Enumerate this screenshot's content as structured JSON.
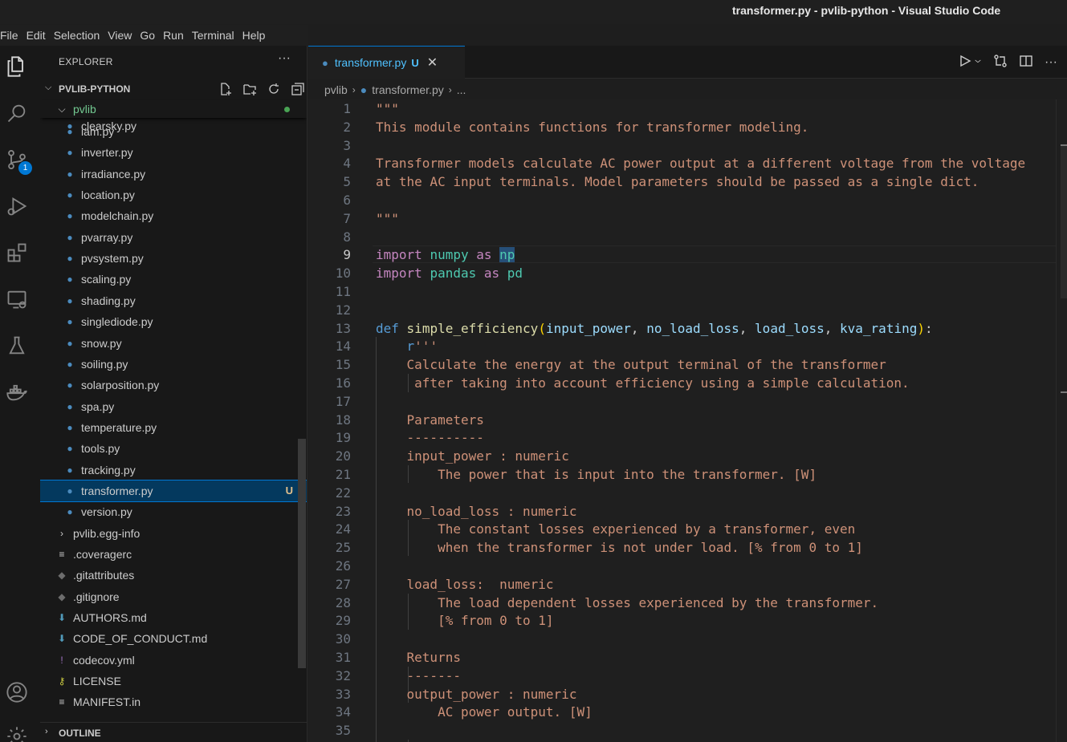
{
  "window": {
    "title": "transformer.py - pvlib-python - Visual Studio Code"
  },
  "menu": [
    "File",
    "Edit",
    "Selection",
    "View",
    "Go",
    "Run",
    "Terminal",
    "Help"
  ],
  "activity_bar": {
    "scm_badge": "1"
  },
  "explorer": {
    "header": "EXPLORER",
    "more": "···",
    "project": "PVLIB-PYTHON",
    "folder": "pvlib",
    "files": [
      {
        "name": "clearsky.py"
      },
      {
        "name": "iam.py"
      },
      {
        "name": "inverter.py"
      },
      {
        "name": "irradiance.py"
      },
      {
        "name": "location.py"
      },
      {
        "name": "modelchain.py"
      },
      {
        "name": "pvarray.py"
      },
      {
        "name": "pvsystem.py"
      },
      {
        "name": "scaling.py"
      },
      {
        "name": "shading.py"
      },
      {
        "name": "singlediode.py"
      },
      {
        "name": "snow.py"
      },
      {
        "name": "soiling.py"
      },
      {
        "name": "solarposition.py"
      },
      {
        "name": "spa.py"
      },
      {
        "name": "temperature.py"
      },
      {
        "name": "tools.py"
      },
      {
        "name": "tracking.py"
      },
      {
        "name": "transformer.py",
        "status": "U",
        "selected": true
      },
      {
        "name": "version.py"
      }
    ],
    "root_items": [
      {
        "name": "pvlib.egg-info",
        "icon": "chevron-right-icon"
      },
      {
        "name": ".coveragerc",
        "icon": "lines-icon"
      },
      {
        "name": ".gitattributes",
        "icon": "git-icon"
      },
      {
        "name": ".gitignore",
        "icon": "git-icon"
      },
      {
        "name": "AUTHORS.md",
        "icon": "markdown-icon"
      },
      {
        "name": "CODE_OF_CONDUCT.md",
        "icon": "markdown-icon"
      },
      {
        "name": "codecov.yml",
        "icon": "yaml-icon"
      },
      {
        "name": "LICENSE",
        "icon": "license-icon"
      },
      {
        "name": "MANIFEST.in",
        "icon": "lines-icon"
      }
    ],
    "outline": "OUTLINE"
  },
  "tab": {
    "name": "transformer.py",
    "status": "U"
  },
  "breadcrumb": {
    "folder": "pvlib",
    "file": "transformer.py",
    "more": "..."
  },
  "editor": {
    "current_line": 9,
    "lines": [
      "\"\"\"",
      "This module contains functions for transformer modeling.",
      "",
      "Transformer models calculate AC power output at a different voltage from the voltage",
      "at the AC input terminals. Model parameters should be passed as a single dict.",
      "",
      "\"\"\"",
      "",
      "import numpy as np",
      "import pandas as pd",
      "",
      "",
      "def simple_efficiency(input_power, no_load_loss, load_loss, kva_rating):",
      "    r'''",
      "    Calculate the energy at the output terminal of the transformer",
      "     after taking into account efficiency using a simple calculation.",
      "",
      "    Parameters",
      "    ----------",
      "    input_power : numeric",
      "        The power that is input into the transformer. [W]",
      "",
      "    no_load_loss : numeric",
      "        The constant losses experienced by a transformer, even",
      "        when the transformer is not under load. [% from 0 to 1]",
      "",
      "    load_loss:  numeric",
      "        The load dependent losses experienced by the transformer.",
      "        [% from 0 to 1]",
      "",
      "    Returns",
      "    -------",
      "    output_power : numeric",
      "        AC power output. [W]",
      ""
    ]
  },
  "colors": {
    "accent": "#0078d4",
    "string": "#ce9178",
    "keyword": "#c586c0",
    "def_keyword": "#569cd6",
    "module": "#4ec9b0",
    "function": "#dcdcaa",
    "parameter": "#9cdcfe",
    "untracked": "#e2c08d"
  }
}
